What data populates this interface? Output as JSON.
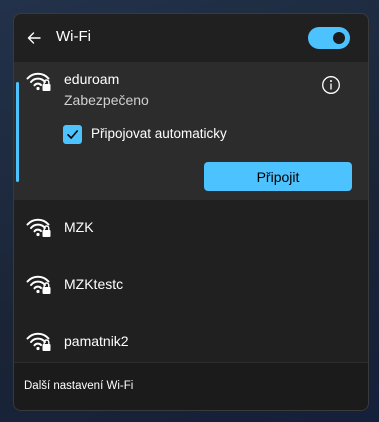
{
  "header": {
    "title": "Wi-Fi",
    "wifi_enabled": true
  },
  "selected_network": {
    "name": "eduroam",
    "status": "Zabezpečeno",
    "auto_connect_label": "Připojovat automaticky",
    "auto_connect_checked": true,
    "connect_label": "Připojit"
  },
  "networks": [
    {
      "name": "MZK",
      "secured": true
    },
    {
      "name": "MZKtestc",
      "secured": true
    },
    {
      "name": "pamatnik2",
      "secured": true
    }
  ],
  "footer": {
    "settings_link": "Další nastavení Wi-Fi"
  },
  "colors": {
    "accent": "#4cc2ff",
    "panel_background": "#202020",
    "selected_background": "#2c2c2c"
  },
  "icons": {
    "back": "back-arrow-icon",
    "wifi": "wifi-secured-icon",
    "info": "info-icon",
    "check": "check-icon"
  }
}
